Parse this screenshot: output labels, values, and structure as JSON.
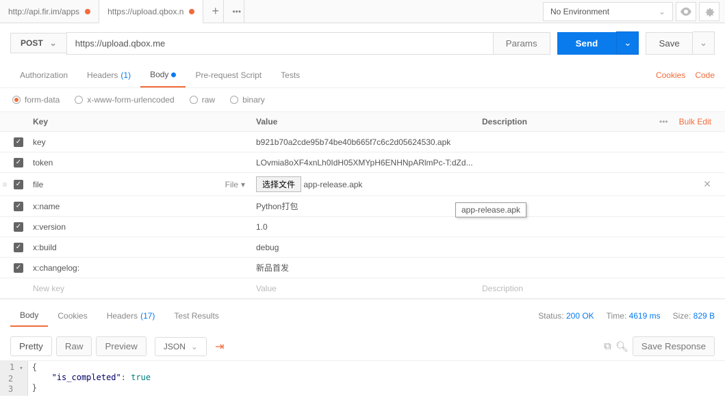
{
  "tabs": [
    {
      "label": "http://api.fir.im/apps",
      "modified": true,
      "active": false
    },
    {
      "label": "https://upload.qbox.n",
      "modified": true,
      "active": true
    }
  ],
  "env": {
    "label": "No Environment"
  },
  "method": "POST",
  "url": "https://upload.qbox.me",
  "buttons": {
    "params": "Params",
    "send": "Send",
    "save": "Save"
  },
  "req_tabs": {
    "auth": "Authorization",
    "headers": "Headers",
    "headers_count": "(1)",
    "body": "Body",
    "prescript": "Pre-request Script",
    "tests": "Tests"
  },
  "right_links": {
    "cookies": "Cookies",
    "code": "Code"
  },
  "body_types": {
    "formdata": "form-data",
    "urlenc": "x-www-form-urlencoded",
    "raw": "raw",
    "binary": "binary"
  },
  "kv_headers": {
    "key": "Key",
    "value": "Value",
    "desc": "Description",
    "bulk": "Bulk Edit"
  },
  "rows": [
    {
      "key": "key",
      "value": "b921b70a2cde95b74be40b665f7c6c2d05624530.apk",
      "type": "text"
    },
    {
      "key": "token",
      "value": "LOvmia8oXF4xnLh0IdH05XMYpH6ENHNpARlmPc-T:dZd...",
      "type": "text"
    },
    {
      "key": "file",
      "value_btn": "选择文件",
      "value_file": "app-release.apk",
      "type": "file",
      "type_label": "File",
      "show_x": true,
      "show_handle": true
    },
    {
      "key": "x:name",
      "value": "Python打包",
      "type": "text"
    },
    {
      "key": "x:version",
      "value": "1.0",
      "type": "text"
    },
    {
      "key": "x:build",
      "value": "debug",
      "type": "text"
    },
    {
      "key": "x:changelog:",
      "value": "新品首发",
      "type": "text"
    }
  ],
  "placeholder_row": {
    "key": "New key",
    "value": "Value",
    "desc": "Description"
  },
  "tooltip": "app-release.apk",
  "resp_tabs": {
    "body": "Body",
    "cookies": "Cookies",
    "headers": "Headers",
    "headers_count": "(17)",
    "tests": "Test Results"
  },
  "status": {
    "status_l": "Status:",
    "status_v": "200 OK",
    "time_l": "Time:",
    "time_v": "4619 ms",
    "size_l": "Size:",
    "size_v": "829 B"
  },
  "view": {
    "pretty": "Pretty",
    "raw": "Raw",
    "preview": "Preview",
    "json": "JSON",
    "save_resp": "Save Response"
  },
  "json_lines": {
    "l1": "{",
    "l2k": "\"is_completed\"",
    "l2c": ": ",
    "l2v": "true",
    "l3": "}"
  }
}
